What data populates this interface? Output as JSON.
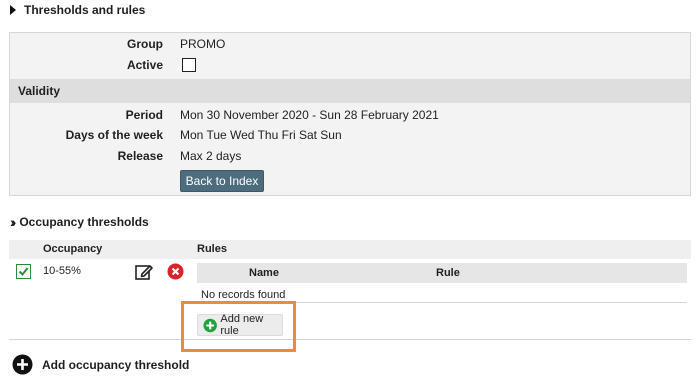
{
  "thresholds": {
    "title": "Thresholds and rules"
  },
  "general": {
    "group_label": "Group",
    "group_value": "PROMO",
    "active_label": "Active"
  },
  "validity": {
    "title": "Validity",
    "period_label": "Period",
    "period_value": "Mon 30 November 2020 - Sun 28 February 2021",
    "days_label": "Days of the week",
    "days_value": "Mon Tue Wed Thu Fri Sat Sun",
    "release_label": "Release",
    "release_value": "Max 2 days",
    "back_button": "Back to Index"
  },
  "occupancy": {
    "title": "Occupancy thresholds",
    "col_occupancy": "Occupancy",
    "col_rules": "Rules",
    "row_value": "10-55%",
    "rules_col_name": "Name",
    "rules_col_rule": "Rule",
    "no_records": "No records found",
    "add_rule_button": "Add new rule",
    "add_threshold": "Add occupancy threshold"
  },
  "colors": {
    "button_bg": "#4d6d7e",
    "highlight": "#f28a2e",
    "check_green": "#2e8b3d",
    "delete_red": "#d9222a",
    "add_green": "#22a23a"
  }
}
